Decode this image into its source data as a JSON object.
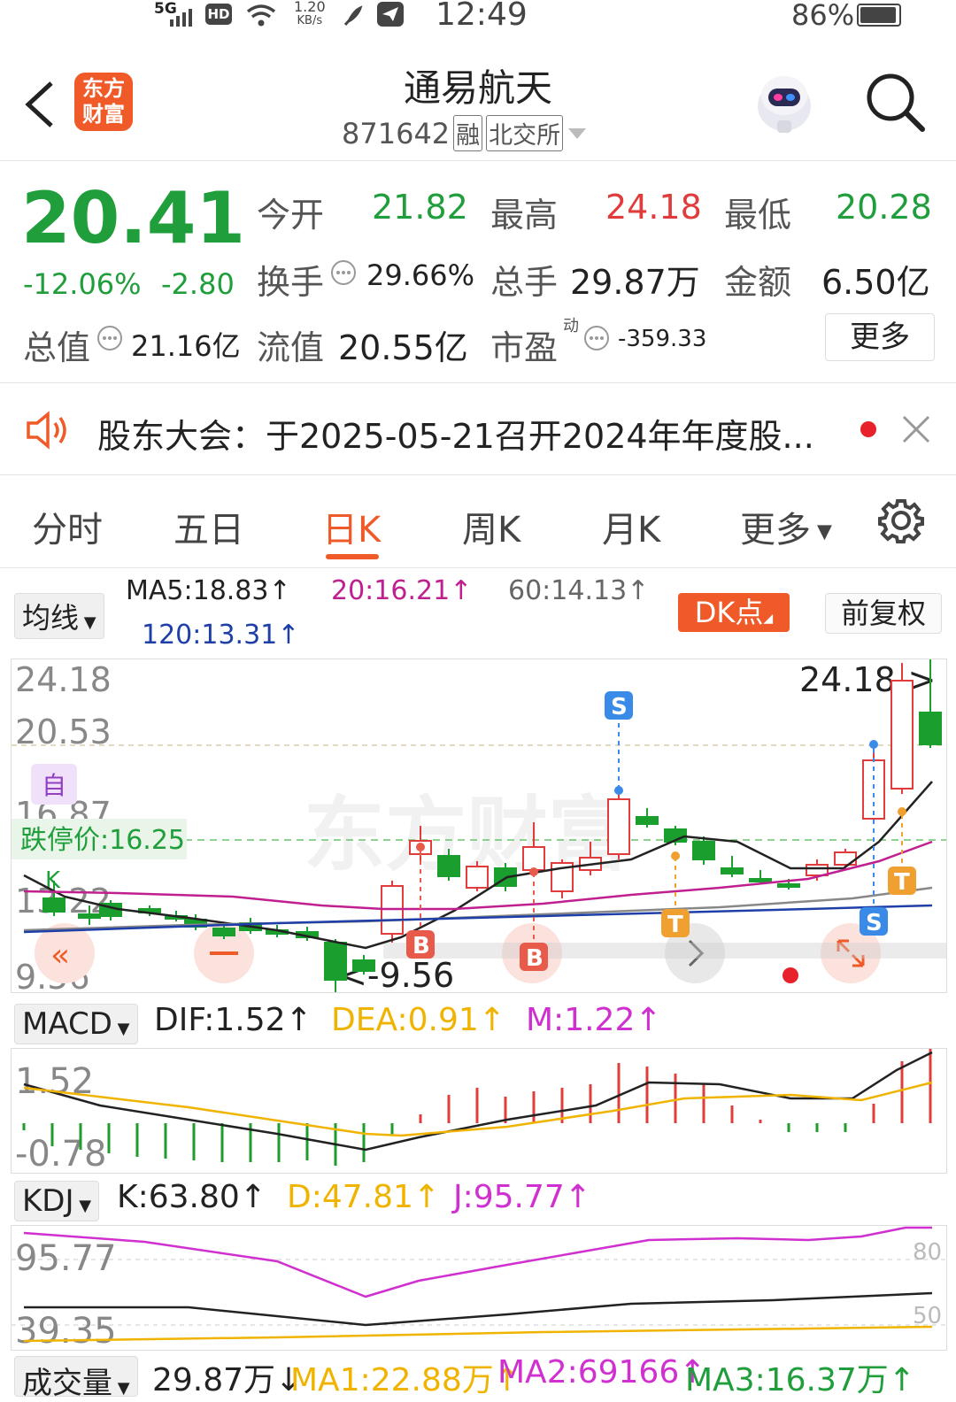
{
  "status_bar": {
    "network": "5G",
    "hd": "HD",
    "speed_value": "1.20",
    "speed_unit": "KB/s",
    "time": "12:49",
    "battery": "86%"
  },
  "header": {
    "title": "通易航天",
    "code": "871642",
    "tag_margin": "融",
    "tag_exchange": "北交所",
    "logo_line1": "东方",
    "logo_line2": "财富"
  },
  "quote": {
    "price": "20.41",
    "change_pct": "-12.06%",
    "change": "-2.80",
    "open_label": "今开",
    "open": "21.82",
    "high_label": "最高",
    "high": "24.18",
    "low_label": "最低",
    "low": "20.28",
    "turnover_label": "换手",
    "turnover": "29.66%",
    "volume_label": "总手",
    "volume": "29.87万",
    "amount_label": "金额",
    "amount": "6.50亿",
    "mktcap_label": "总值",
    "mktcap": "21.16亿",
    "float_label": "流值",
    "float": "20.55亿",
    "pe_label": "市盈",
    "pe_sup": "动",
    "pe": "-359.33",
    "more": "更多"
  },
  "notice": {
    "text": "股东大会：于2025-05-21召开2024年年度股..."
  },
  "tabs": [
    "分时",
    "五日",
    "日K",
    "周K",
    "月K",
    "更多"
  ],
  "active_tab": 2,
  "ma_bar": {
    "selector": "均线",
    "ma5": "MA5:18.83↑",
    "ma20": "20:16.21↑",
    "ma60": "60:14.13↑",
    "ma120": "120:13.31↑",
    "dk": "DK点",
    "adjust": "前复权"
  },
  "kline": {
    "axis_top": "24.18",
    "axis_2": "20.53",
    "axis_3": "16.87",
    "axis_4": "13.22",
    "axis_bottom": "9.56",
    "high_marker": "24.18->",
    "low_marker": "<-9.56",
    "limit_down": "跌停价:16.25",
    "watermark": "东方财富",
    "tag_self": "自",
    "tag_k": "K",
    "sig_S": "S",
    "sig_B": "B",
    "sig_T": "T"
  },
  "macd": {
    "selector": "MACD",
    "dif": "DIF:1.52↑",
    "dea": "DEA:0.91↑",
    "m": "M:1.22↑",
    "axis_top": "1.52",
    "axis_bottom": "-0.78"
  },
  "kdj": {
    "selector": "KDJ",
    "k": "K:63.80↑",
    "d": "D:47.81↑",
    "j": "J:95.77↑",
    "axis_top": "95.77",
    "axis_bottom": "39.35",
    "ref80": "80",
    "ref50": "50"
  },
  "volume": {
    "selector": "成交量",
    "vol": "29.87万↓",
    "ma1": "MA1:22.88万↑",
    "ma2": "MA2:69166↑",
    "ma3": "MA3:16.37万↑"
  },
  "colors": {
    "up": "#e03c3c",
    "down": "#1a9e2e",
    "accent": "#f05a28",
    "ma20": "#c0208f",
    "ma60": "#888888",
    "ma120": "#1f3fa8",
    "dea": "#f0b400",
    "j": "#d030d0"
  }
}
